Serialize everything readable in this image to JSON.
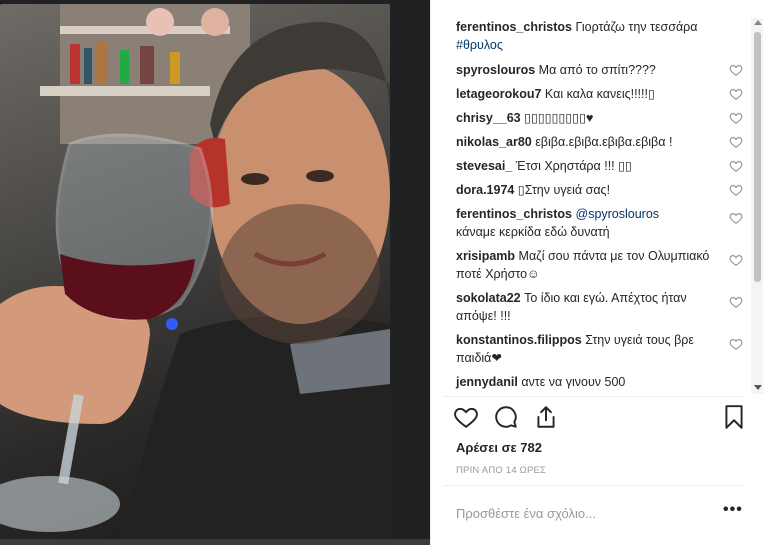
{
  "post": {
    "caption_user": "ferentinos_christos",
    "caption_text": "Γιορτάζω την τεσσάρα",
    "caption_hashtag": "#θρυλος"
  },
  "comments": [
    {
      "user": "spyroslouros",
      "text": "Μα από το σπίτι????"
    },
    {
      "user": "letageorokou7",
      "text": "Και καλα κανεις!!!!!▯"
    },
    {
      "user": "chrisy__63",
      "text": "▯▯▯▯▯▯▯▯▯♥"
    },
    {
      "user": "nikolas_ar80",
      "text": "εβιβα.εβιβα.εβιβα.εβιβα !"
    },
    {
      "user": "stevesai_",
      "text": "Έτσι Χρηστάρα !!! ▯▯"
    },
    {
      "user": "dora.1974",
      "text": "▯Στην υγειά σας!"
    },
    {
      "user": "ferentinos_christos",
      "mention": "@spyroslouros",
      "text": "κάναμε κερκίδα εδώ δυνατή"
    },
    {
      "user": "xrisipamb",
      "text": "Μαζί σου πάντα με τον Ολυμπιακό ποτέ Χρήστο☺"
    },
    {
      "user": "sokolata22",
      "text": "Το ίδιο και εγώ. Απέχτος ήταν απόψε! !!!"
    },
    {
      "user": "konstantinos.filippos",
      "text": "Στην υγειά τους βρε παιδιά❤"
    },
    {
      "user": "jennydanil",
      "text": "αντε να γινουν 500"
    }
  ],
  "actions": {
    "like_icon": "heart-outline-icon",
    "comment_icon": "comment-bubble-icon",
    "share_icon": "share-upload-icon",
    "save_icon": "bookmark-icon"
  },
  "likes_text": "Αρέσει σε 782",
  "timestamp": "ΠΡΙΝ ΑΠΟ 14 ΩΡΕΣ",
  "add_comment_placeholder": "Προσθέστε ένα σχόλιο...",
  "more_label": "•••",
  "colors": {
    "link": "#003569",
    "muted": "#999999",
    "text": "#262626"
  }
}
